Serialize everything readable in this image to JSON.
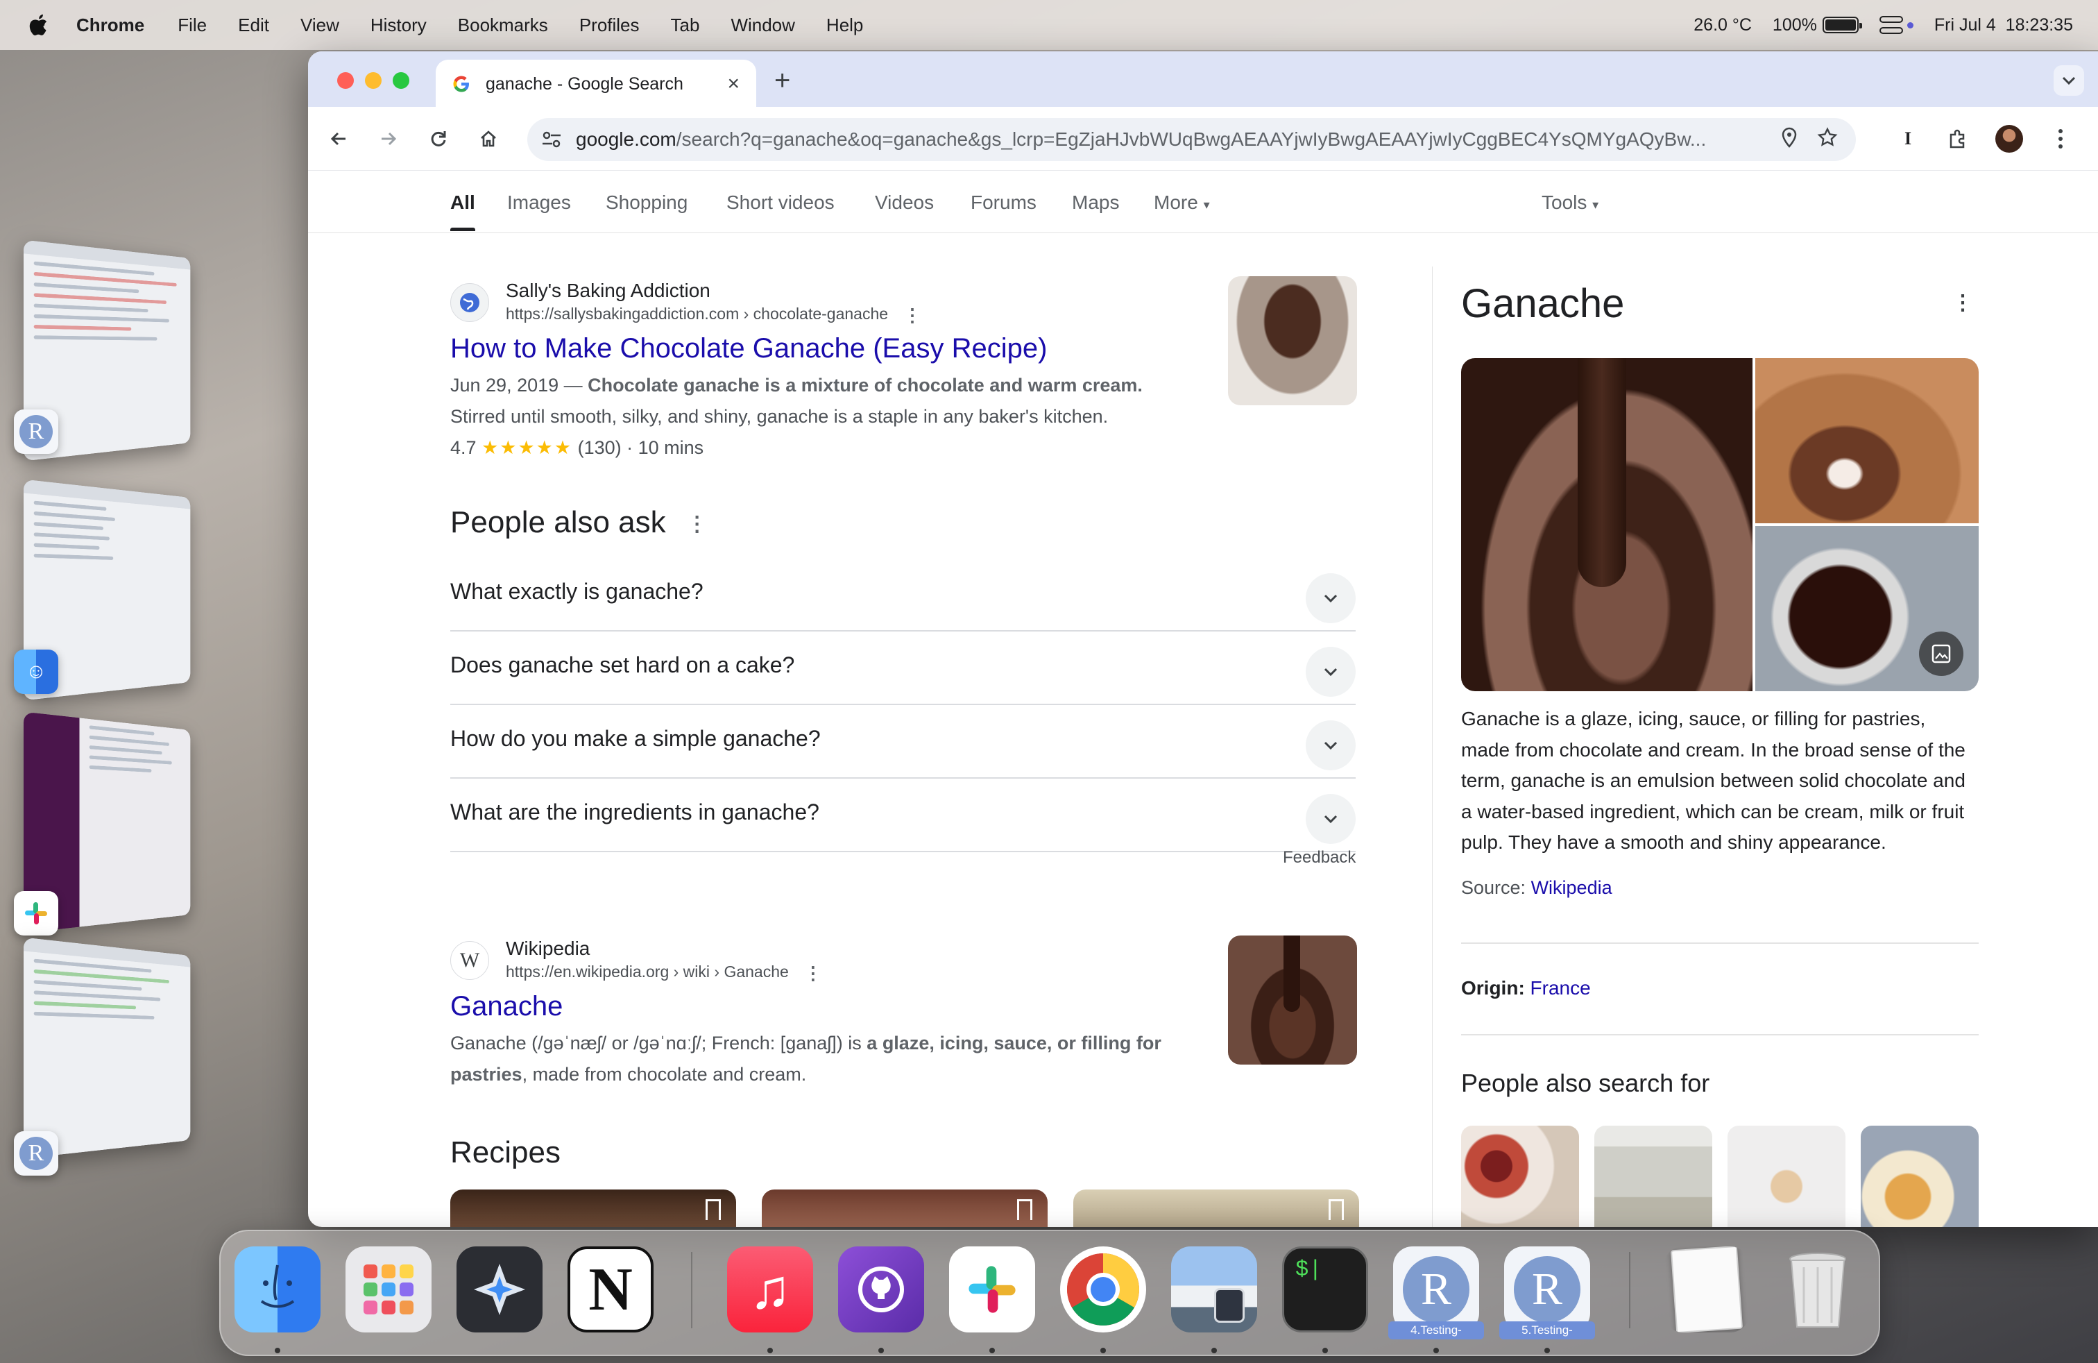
{
  "menubar": {
    "app": "Chrome",
    "items": [
      "File",
      "Edit",
      "View",
      "History",
      "Bookmarks",
      "Profiles",
      "Tab",
      "Window",
      "Help"
    ],
    "temperature": "26.0 °C",
    "battery": "100%",
    "battery_level": 1.0,
    "datetime": "Fri Jul 4  18:23:35"
  },
  "browser": {
    "tab_title": "ganache - Google Search",
    "url_host": "google.com",
    "url_rest": "/search?q=ganache&oq=ganache&gs_lcrp=EgZjaHJvbWUqBwgAEAAYjwIyBwgAEAAYjwIyCggBEC4YsQMYgAQyBw..."
  },
  "search_tabs": [
    "All",
    "Images",
    "Shopping",
    "Short videos",
    "Videos",
    "Forums",
    "Maps",
    "More"
  ],
  "tools_label": "Tools",
  "results": [
    {
      "site": "Sally's Baking Addiction",
      "url": "https://sallysbakingaddiction.com › chocolate-ganache",
      "title": "How to Make Chocolate Ganache (Easy Recipe)",
      "date": "Jun 29, 2019 — ",
      "snippet_bold": "Chocolate ganache is a mixture of chocolate and warm cream.",
      "snippet_rest": "Stirred until smooth, silky, and shiny, ganache is a staple in any baker's kitchen.",
      "rating": "4.7",
      "stars": "★★★★★",
      "reviews": "(130)",
      "time": " · 10 mins"
    },
    {
      "site": "Wikipedia",
      "favicon": "W",
      "url": "https://en.wikipedia.org › wiki › Ganache",
      "title": "Ganache",
      "snippet_pre": "Ganache (/ɡəˈnæʃ/ or /ɡəˈnɑːʃ/; French: [ganaʃ]) is ",
      "snippet_bold": "a glaze, icing, sauce, or filling for pastries",
      "snippet_post": ", made from chocolate and cream."
    }
  ],
  "paa": {
    "heading": "People also ask",
    "questions": [
      "What exactly is ganache?",
      "Does ganache set hard on a cake?",
      "How do you make a simple ganache?",
      "What are the ingredients in ganache?"
    ],
    "feedback": "Feedback"
  },
  "recipes_heading": "Recipes",
  "knowledge_panel": {
    "title": "Ganache",
    "description": "Ganache is a glaze, icing, sauce, or filling for pastries, made from chocolate and cream. In the broad sense of the term, ganache is an emulsion between solid chocolate and a water-based ingredient, which can be cream, milk or fruit pulp. They have a smooth and shiny appearance.",
    "source_label": "Source: ",
    "source_link": "Wikipedia",
    "origin_label": "Origin: ",
    "origin_value": "France",
    "pasf_heading": "People also search for"
  },
  "dock": {
    "apps": [
      "Finder",
      "Launchpad",
      "Safari Technology Preview",
      "Notion",
      "Music",
      "GitHub Desktop",
      "Slack",
      "Google Chrome",
      "Preview",
      "Terminal",
      "R",
      "R"
    ],
    "r_labels": [
      "4.Testing-",
      "5.Testing-"
    ]
  },
  "colors": {
    "link": "#1a0dab",
    "accent": "#4285f4",
    "tab_strip": "#dde3f6"
  }
}
